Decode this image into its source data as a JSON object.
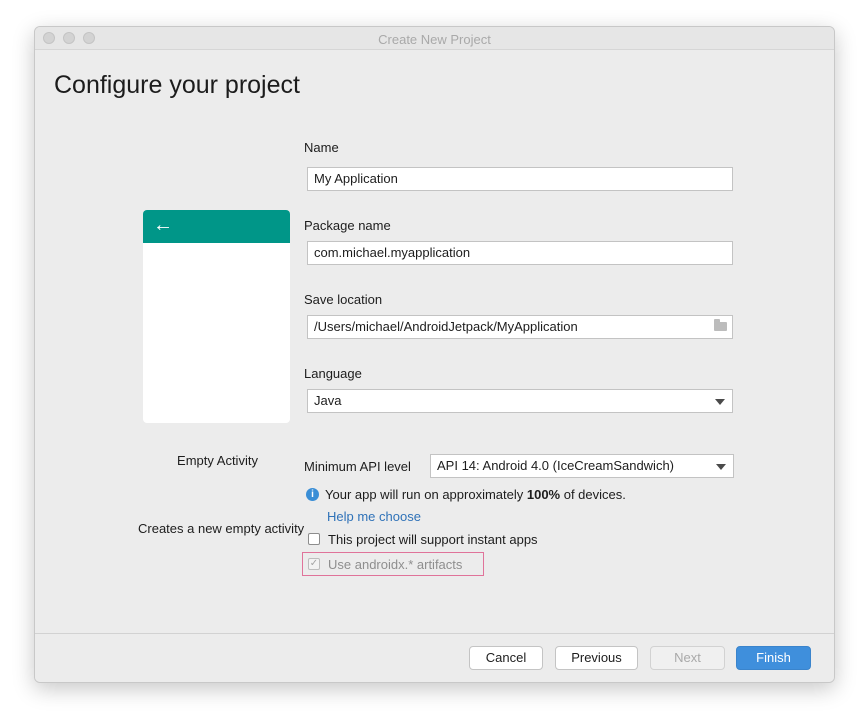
{
  "window": {
    "title": "Create New Project"
  },
  "page_title": "Configure your project",
  "activity": {
    "name": "Empty Activity",
    "description": "Creates a new empty activity",
    "preview_color": "#009688",
    "back_icon": "arrow-left-icon"
  },
  "form": {
    "name": {
      "label": "Name",
      "value": "My Application"
    },
    "package": {
      "label": "Package name",
      "value": "com.michael.myapplication"
    },
    "save_location": {
      "label": "Save location",
      "value": "/Users/michael/AndroidJetpack/MyApplication",
      "icon": "folder-icon"
    },
    "language": {
      "label": "Language",
      "value": "Java"
    },
    "min_api": {
      "label": "Minimum API level",
      "value": "API 14: Android 4.0 (IceCreamSandwich)"
    },
    "info": {
      "prefix": "Your app will run on approximately ",
      "percent": "100%",
      "suffix": " of devices.",
      "icon": "info-icon"
    },
    "help_link": "Help me choose",
    "instant_apps": {
      "label": "This project will support instant apps",
      "checked": false
    },
    "androidx": {
      "label": "Use androidx.* artifacts",
      "checked": true,
      "disabled": true
    }
  },
  "buttons": {
    "cancel": "Cancel",
    "previous": "Previous",
    "next": "Next",
    "finish": "Finish"
  },
  "colors": {
    "accent": "#3f8fdc",
    "link": "#2f72b8",
    "highlight": "#e0739a"
  }
}
